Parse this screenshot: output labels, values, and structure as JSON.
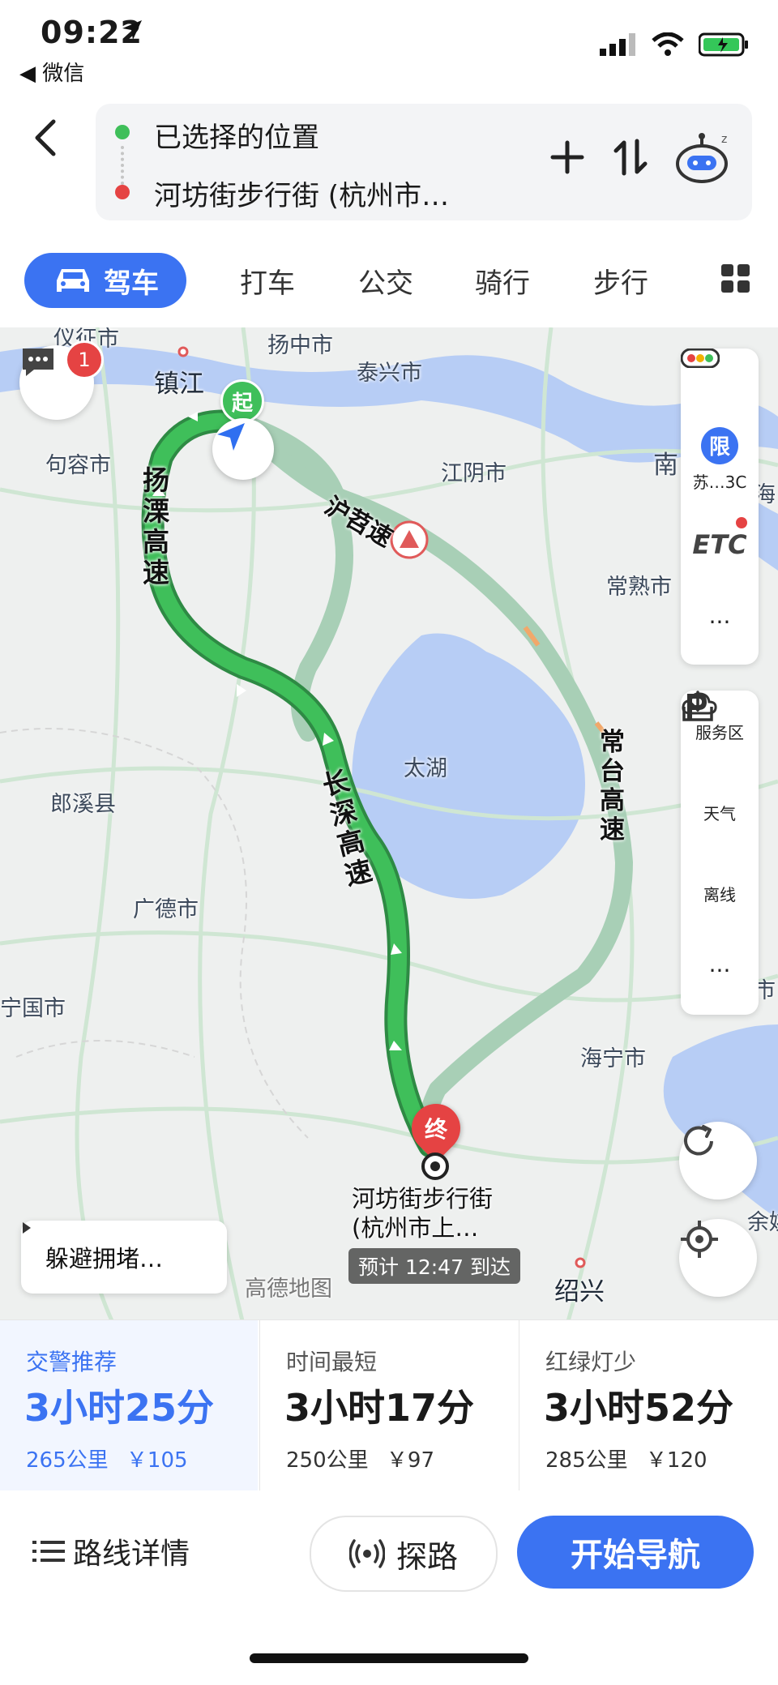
{
  "status": {
    "time": "09:22",
    "back_app": "◀ 微信"
  },
  "route": {
    "origin": "已选择的位置",
    "destination": "河坊街步行街 (杭州市…"
  },
  "tabs": [
    "驾车",
    "打车",
    "公交",
    "骑行",
    "步行"
  ],
  "map": {
    "labels": [
      {
        "text": "仪征市"
      },
      {
        "text": "扬中市"
      },
      {
        "text": "泰兴市"
      },
      {
        "text": "镇江"
      },
      {
        "text": "句容市"
      },
      {
        "text": "江阴市"
      },
      {
        "text": "南"
      },
      {
        "text": "海"
      },
      {
        "text": "常熟市"
      },
      {
        "text": "太湖"
      },
      {
        "text": "郎溪县"
      },
      {
        "text": "广德市"
      },
      {
        "text": "宁国市"
      },
      {
        "text": "海宁市"
      },
      {
        "text": "绍兴"
      },
      {
        "text": "余姚"
      },
      {
        "text": "市"
      }
    ],
    "road_labels": {
      "yangli": "扬溧高速",
      "changshen": "长深高速",
      "huyi": "沪苕速",
      "changtai": "常台高速"
    },
    "start_marker": "起",
    "end_marker": "终",
    "destination_label_1": "河坊街步行街",
    "destination_label_2": "(杭州市上…",
    "eta": "预计 12:47 到达",
    "watermark": "高德地图",
    "message_badge": "1",
    "avoid_congestion": "躲避拥堵…",
    "side_panel": {
      "limit": "限",
      "limit_plate": "苏…3C",
      "etc": "ETC",
      "more": "···",
      "service": "服务区",
      "weather": "天气",
      "offline": "离线"
    }
  },
  "options": [
    {
      "label": "交警推荐",
      "time": "3小时25分",
      "distance": "265公里",
      "toll": "￥105",
      "highlight": true
    },
    {
      "label": "时间最短",
      "time": "3小时17分",
      "distance": "250公里",
      "toll": "￥97",
      "highlight": false
    },
    {
      "label": "红绿灯少",
      "time": "3小时52分",
      "distance": "285公里",
      "toll": "￥120",
      "highlight": false
    }
  ],
  "bottom": {
    "details": "路线详情",
    "explore": "探路",
    "start": "开始导航"
  },
  "colors": {
    "accent": "#3b73f2",
    "route_main": "#3fbf5a",
    "route_alt": "#a8cfb6",
    "lake": "#b7cdf5",
    "end_marker": "#e54343"
  }
}
